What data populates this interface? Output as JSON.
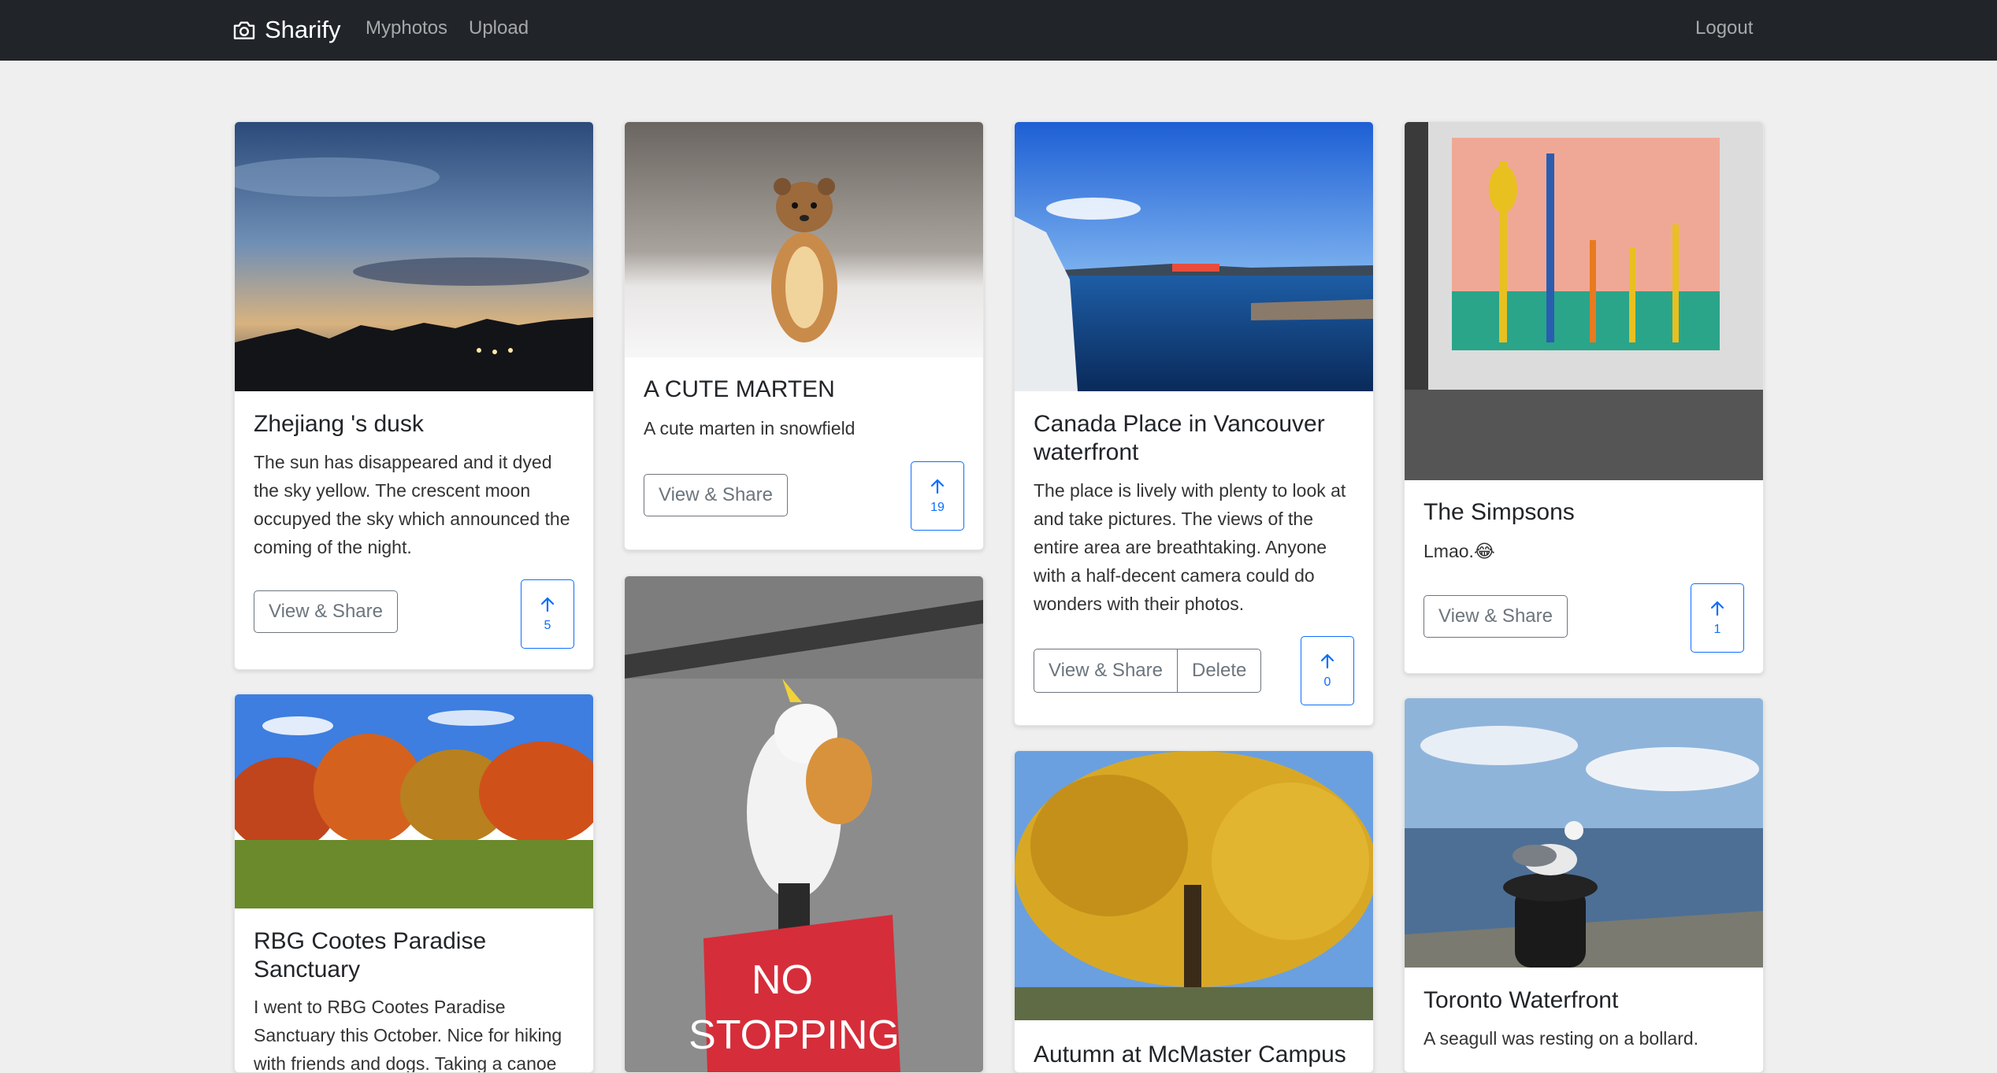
{
  "navbar": {
    "brand": "Sharify",
    "links": [
      "Myphotos",
      "Upload"
    ],
    "logout": "Logout"
  },
  "cards": [
    {
      "title": "Zhejiang 's dusk",
      "text": "The sun has disappeared and it dyed the sky yellow. The crescent moon occupyed the sky which announced the coming of the night.",
      "view": "View & Share",
      "upvotes": "5",
      "image": "dusk sky over campus silhouette"
    },
    {
      "title": "A CUTE MARTEN",
      "text": "A cute marten in snowfield",
      "view": "View & Share",
      "upvotes": "19",
      "image": "marten sitting in snow"
    },
    {
      "title": "Canada Place in Vancouver waterfront",
      "text": "The place is lively with plenty to look at and take pictures. The views of the entire area are breathtaking. Anyone with a half-decent camera could do wonders with their photos.",
      "view": "View & Share",
      "delete": "Delete",
      "upvotes": "0",
      "image": "harbour with blue water and piers"
    },
    {
      "title": "The Simpsons",
      "text": "Lmao.😂",
      "view": "View & Share",
      "upvotes": "1",
      "image": "pink wooden board with garden tools"
    },
    {
      "title": "RBG Cootes Paradise Sanctuary",
      "text": "I went to RBG Cootes Paradise Sanctuary this October. Nice for hiking with friends and dogs. Taking a canoe",
      "image": "autumn trees beside grass field"
    },
    {
      "title": "",
      "text": "",
      "image": "cockatoo eating croissant on NO STOPPING sign",
      "sign_text": "NO STOPPING"
    },
    {
      "title": "Autumn at McMaster Campus",
      "text": "",
      "image": "large tree with yellow leaves"
    },
    {
      "title": "Toronto Waterfront",
      "text": "A seagull was resting on a bollard.",
      "image": "seagull on bollard by lake"
    }
  ]
}
